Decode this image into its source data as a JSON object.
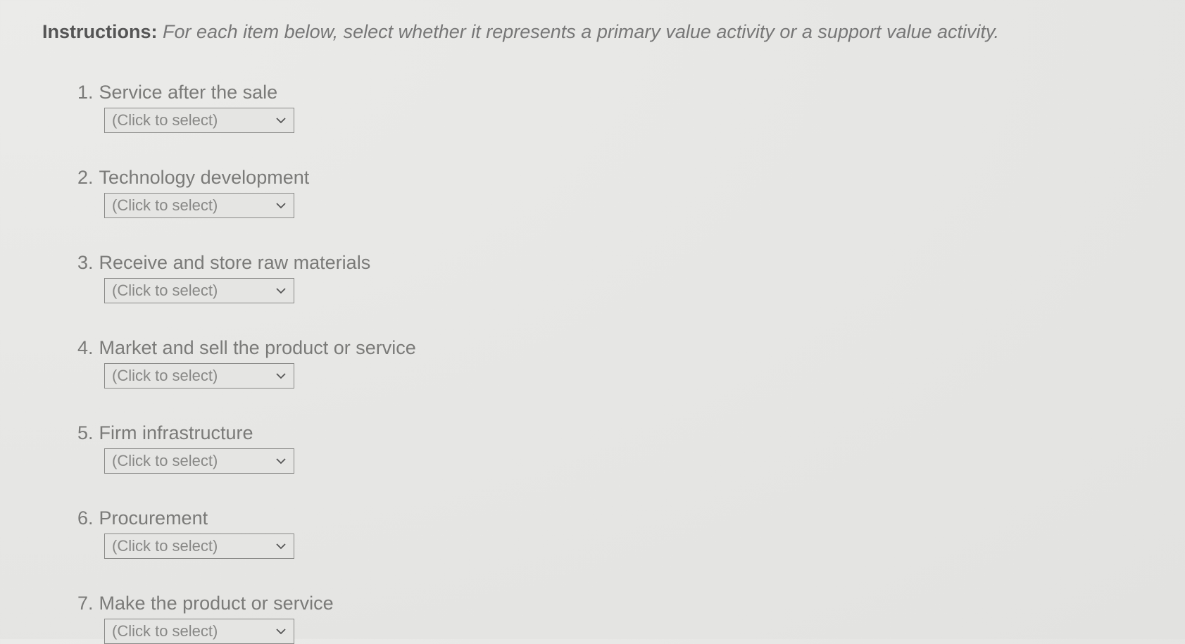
{
  "instructions": {
    "label": "Instructions:",
    "text": "For each item below, select whether it represents a primary value activity or a support value activity."
  },
  "dropdown_placeholder": "(Click to select)",
  "questions": [
    {
      "number": "1.",
      "text": "Service after the sale"
    },
    {
      "number": "2.",
      "text": "Technology development"
    },
    {
      "number": "3.",
      "text": "Receive and store raw materials"
    },
    {
      "number": "4.",
      "text": "Market and sell the product or service"
    },
    {
      "number": "5.",
      "text": "Firm infrastructure"
    },
    {
      "number": "6.",
      "text": "Procurement"
    },
    {
      "number": "7.",
      "text": "Make the product or service"
    }
  ]
}
